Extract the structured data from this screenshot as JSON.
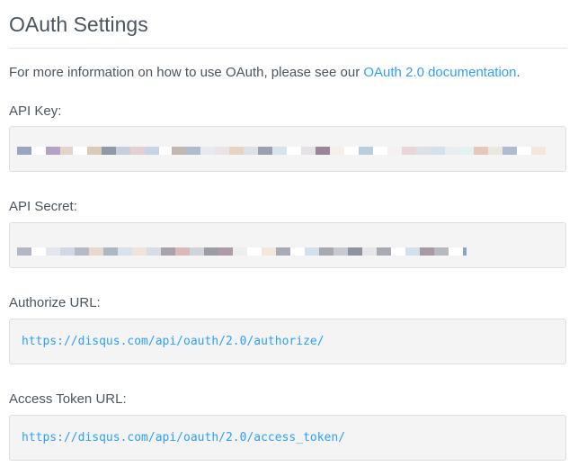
{
  "page": {
    "title": "OAuth Settings",
    "info_prefix": "For more information on how to use OAuth, please see our ",
    "info_link": "OAuth 2.0 documentation",
    "info_suffix": "."
  },
  "fields": {
    "api_key": {
      "label": "API Key:",
      "blurred": true,
      "pixel_colors": [
        "#9aa6c0",
        "#ffffff",
        "#b5a3c4",
        "#e4d3c8",
        "#ffffff",
        "#dacbb9",
        "#8f9aa8",
        "#c7cfdc",
        "#e4cfd2",
        "#c7d4e6",
        "#ffffff",
        "#c4b6b1",
        "#b0bbd0",
        "#e6e9ee",
        "#e9e2e6",
        "#e6d3c4",
        "#dde0e6",
        "#9a9fb2",
        "#d6e5eb",
        "#ffffff",
        "#e4e2e5",
        "#9c8499",
        "#f6eeea",
        "#ffffff",
        "#b9cddf",
        "#ffffff",
        "#f5f0f2",
        "#ead6d8",
        "#dde0e4",
        "#d4e0ea",
        "#e9edf0",
        "#e3f2f0",
        "#e5c8bb",
        "#eae7de",
        "#afbbd2",
        "#ffffff",
        "#f3e6dd"
      ],
      "pixel_widths": [
        16,
        16,
        16,
        14,
        16,
        16,
        16,
        16,
        16,
        16,
        14,
        16,
        16,
        16,
        16,
        16,
        16,
        16,
        16,
        16,
        16,
        16,
        16,
        16,
        16,
        16,
        16,
        16,
        16,
        16,
        16,
        16,
        16,
        16,
        16,
        16,
        16
      ]
    },
    "api_secret": {
      "label": "API Secret:",
      "blurred": true,
      "pixel_colors": [
        "#b3b7c4",
        "#ffffff",
        "#e3e6ec",
        "#cfd8e4",
        "#b6b9c6",
        "#e9d8cd",
        "#aeb7c4",
        "#d8e2ec",
        "#f0e3da",
        "#d7dce6",
        "#a8a2ab",
        "#dab9b8",
        "#cfd4da",
        "#9b9ca4",
        "#ad9ca7",
        "#eeeeee",
        "#ffffff",
        "#f3e6dd",
        "#a8aab8",
        "#ffffff",
        "#d3dfea",
        "#a7a8b0",
        "#c6c9d0",
        "#8e939f",
        "#e6e6e8",
        "#a8abb3",
        "#ffffff",
        "#d3dfea",
        "#a89aa3",
        "#b8b8bf",
        "#ffffff",
        "#8ca5c0"
      ],
      "pixel_widths": [
        16,
        16,
        16,
        16,
        16,
        16,
        16,
        16,
        16,
        16,
        16,
        16,
        16,
        16,
        16,
        16,
        16,
        16,
        16,
        16,
        16,
        16,
        16,
        16,
        16,
        16,
        16,
        16,
        16,
        16,
        16,
        4
      ]
    },
    "authorize_url": {
      "label": "Authorize URL:",
      "value": "https://disqus.com/api/oauth/2.0/authorize/"
    },
    "access_token_url": {
      "label": "Access Token URL:",
      "value": "https://disqus.com/api/oauth/2.0/access_token/"
    }
  },
  "colors": {
    "link": "#2e9fff",
    "text": "#4a5560",
    "box_bg": "#f4f4f4",
    "box_border": "#dde0e3"
  }
}
